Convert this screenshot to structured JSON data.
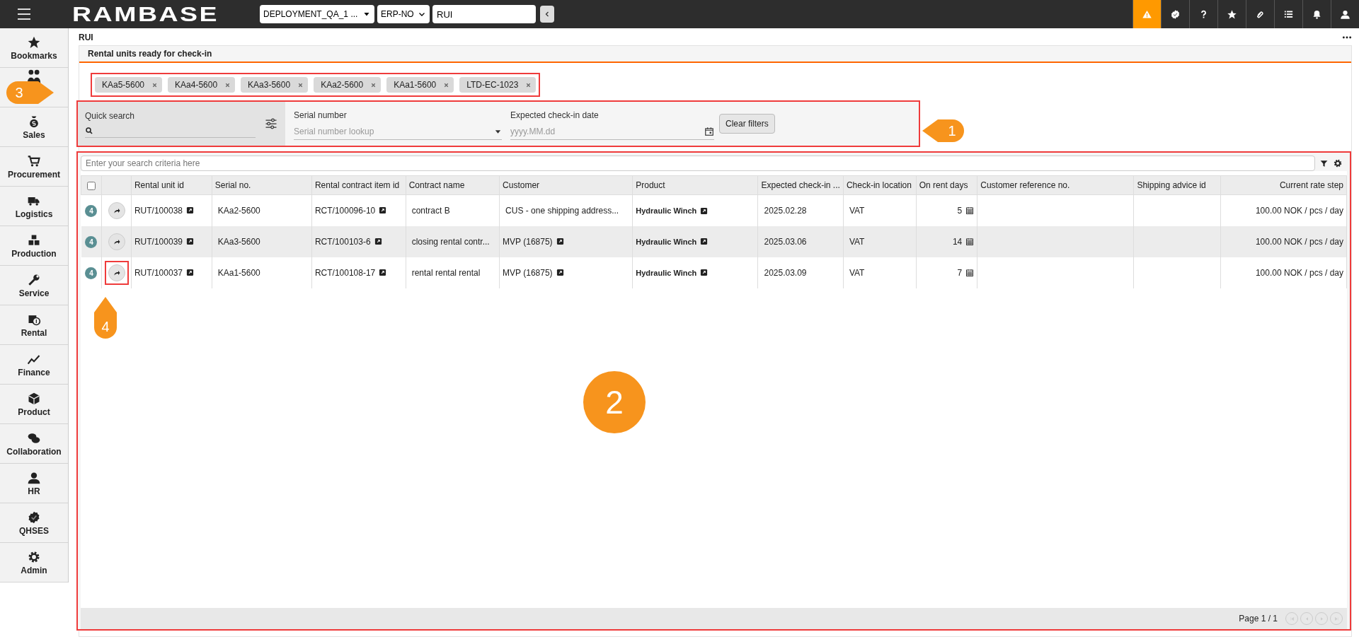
{
  "topbar": {
    "logo": "RAMBASE",
    "environment": "DEPLOYMENT_QA_1 ...",
    "company": "ERP-NO",
    "search_value": "RUI",
    "buttons": [
      {
        "kind": "warning",
        "selected": true
      },
      {
        "kind": "badge",
        "selected": false
      },
      {
        "kind": "help",
        "selected": false
      },
      {
        "kind": "star",
        "selected": false
      },
      {
        "kind": "clip",
        "selected": false
      },
      {
        "kind": "list",
        "selected": false
      },
      {
        "kind": "bell",
        "selected": false
      },
      {
        "kind": "user",
        "selected": false
      }
    ]
  },
  "sidebar": {
    "items": [
      {
        "kind": "star",
        "label": "Bookmarks"
      },
      {
        "kind": "people"
      },
      {
        "kind": "money",
        "label": "Sales"
      },
      {
        "kind": "cart",
        "label": "Procurement"
      },
      {
        "kind": "truck",
        "label": "Logistics"
      },
      {
        "kind": "cubes",
        "label": "Production"
      },
      {
        "kind": "wrench",
        "label": "Service"
      },
      {
        "kind": "rental",
        "label": "Rental"
      },
      {
        "kind": "chart",
        "label": "Finance"
      },
      {
        "kind": "cube",
        "label": "Product"
      },
      {
        "kind": "chat",
        "label": "Collaboration"
      },
      {
        "kind": "user",
        "label": "HR"
      },
      {
        "kind": "badge",
        "label": "QHSES"
      },
      {
        "kind": "gear",
        "label": "Admin"
      }
    ]
  },
  "page_title": "RUI",
  "panel_title": "Rental units ready for check-in",
  "tags": [
    "KAa5-5600",
    "KAa4-5600",
    "KAa3-5600",
    "KAa2-5600",
    "KAa1-5600",
    "LTD-EC-1023"
  ],
  "filters": {
    "quick_search": {
      "label": "Quick search"
    },
    "serial_number": {
      "label": "Serial number",
      "placeholder": "Serial number lookup"
    },
    "date": {
      "label": "Expected check-in date",
      "placeholder": "yyyy.MM.dd"
    },
    "clear_button": "Clear filters"
  },
  "table": {
    "search_placeholder": "Enter your search criteria here",
    "select_all_checked": false,
    "columns": [
      "Rental unit id",
      "Serial no.",
      "Rental contract item id",
      "Contract name",
      "Customer",
      "Product",
      "Expected check-in ...",
      "Check-in location",
      "On rent days",
      "Customer reference no.",
      "Shipping advice id",
      "Current rate step"
    ],
    "rows": [
      {
        "selected": false,
        "highlighted": false,
        "badge": "4",
        "cells": [
          {
            "kind": "link",
            "text": "RUT/100038"
          },
          {
            "kind": "text",
            "text": "KAa2-5600"
          },
          {
            "kind": "link",
            "text": "RCT/100096-10"
          },
          {
            "kind": "text",
            "text": "contract B"
          },
          {
            "kind": "text",
            "text": "CUS - one shipping address..."
          },
          {
            "kind": "bold_link",
            "text": "Hydraulic Winch"
          },
          {
            "kind": "text",
            "text": "2025.02.28"
          },
          {
            "kind": "text",
            "text": "VAT"
          },
          {
            "kind": "days",
            "text": "5"
          },
          {
            "kind": "empty"
          },
          {
            "kind": "empty"
          },
          {
            "kind": "rate",
            "text": "100.00 NOK / pcs / day"
          }
        ]
      },
      {
        "selected": true,
        "highlighted": false,
        "badge": "4",
        "cells": [
          {
            "kind": "link",
            "text": "RUT/100039"
          },
          {
            "kind": "text",
            "text": "KAa3-5600"
          },
          {
            "kind": "link",
            "text": "RCT/100103-6"
          },
          {
            "kind": "text",
            "text": "closing rental contr..."
          },
          {
            "kind": "link",
            "text": "MVP (16875)"
          },
          {
            "kind": "bold_link",
            "text": "Hydraulic Winch"
          },
          {
            "kind": "text",
            "text": "2025.03.06"
          },
          {
            "kind": "text",
            "text": "VAT"
          },
          {
            "kind": "days",
            "text": "14"
          },
          {
            "kind": "empty"
          },
          {
            "kind": "empty"
          },
          {
            "kind": "rate",
            "text": "100.00 NOK / pcs / day"
          }
        ]
      },
      {
        "selected": false,
        "highlighted": true,
        "badge": "4",
        "cells": [
          {
            "kind": "link",
            "text": "RUT/100037"
          },
          {
            "kind": "text",
            "text": "KAa1-5600"
          },
          {
            "kind": "link",
            "text": "RCT/100108-17"
          },
          {
            "kind": "text",
            "text": "rental rental rental"
          },
          {
            "kind": "link",
            "text": "MVP (16875)"
          },
          {
            "kind": "bold_link",
            "text": "Hydraulic Winch"
          },
          {
            "kind": "text",
            "text": "2025.03.09"
          },
          {
            "kind": "text",
            "text": "VAT"
          },
          {
            "kind": "days",
            "text": "7"
          },
          {
            "kind": "empty"
          },
          {
            "kind": "empty"
          },
          {
            "kind": "rate",
            "text": "100.00 NOK / pcs / day"
          }
        ]
      }
    ],
    "pager": "Page 1 / 1"
  },
  "annotations": [
    {
      "label": "1"
    },
    {
      "label": "2"
    },
    {
      "label": "3"
    },
    {
      "label": "4"
    }
  ]
}
